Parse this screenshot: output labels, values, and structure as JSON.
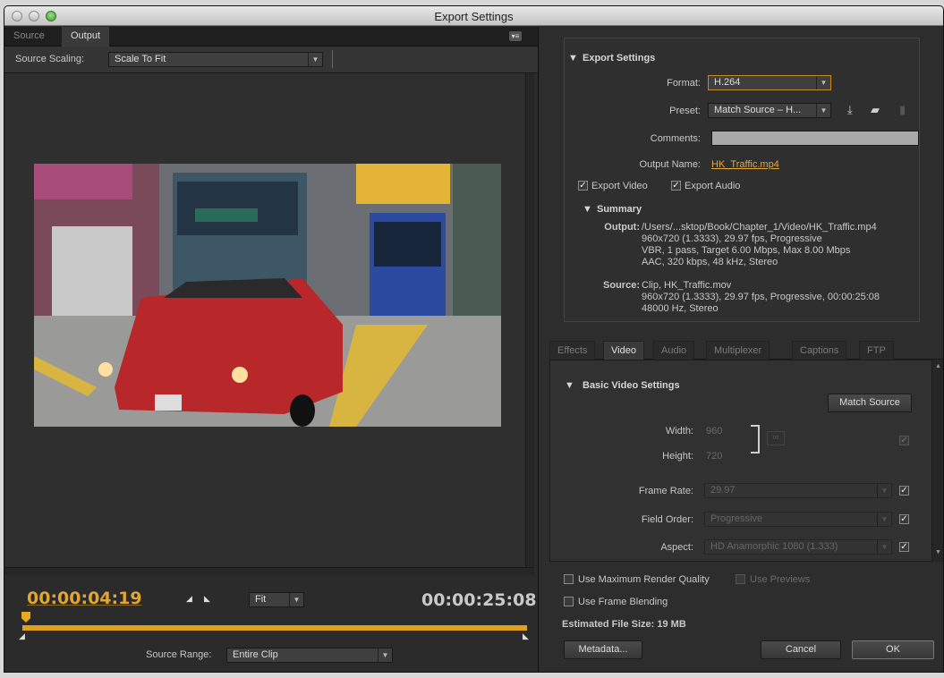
{
  "window": {
    "title": "Export Settings"
  },
  "left": {
    "tabs": [
      "Source",
      "Output"
    ],
    "panel_menu_icon": "panel-menu-icon",
    "source_scaling_label": "Source Scaling:",
    "source_scaling_value": "Scale To Fit",
    "current_time": "00:00:04:19",
    "duration": "00:00:25:08",
    "zoom_value": "Fit",
    "source_range_label": "Source Range:",
    "source_range_value": "Entire Clip"
  },
  "export": {
    "header": "Export Settings",
    "format_label": "Format:",
    "format_value": "H.264",
    "preset_label": "Preset:",
    "preset_value": "Match Source – H...",
    "comments_label": "Comments:",
    "output_name_label": "Output Name:",
    "output_name_value": "HK_Traffic.mp4",
    "export_video_label": "Export Video",
    "export_audio_label": "Export Audio",
    "summary_header": "Summary",
    "output_key": "Output:",
    "output_lines": "/Users/...sktop/Book/Chapter_1/Video/HK_Traffic.mp4\n960x720 (1.3333), 29.97 fps, Progressive\nVBR, 1 pass, Target 6.00 Mbps, Max 8.00 Mbps\nAAC, 320 kbps, 48 kHz, Stereo",
    "source_key": "Source:",
    "source_lines": "Clip, HK_Traffic.mov\n960x720 (1.3333), 29.97 fps, Progressive, 00:00:25:08\n48000 Hz, Stereo"
  },
  "tabs": [
    "Effects",
    "Video",
    "Audio",
    "Multiplexer",
    "Captions",
    "FTP"
  ],
  "video": {
    "header": "Basic Video Settings",
    "match_source_label": "Match Source",
    "width_label": "Width:",
    "width_value": "960",
    "height_label": "Height:",
    "height_value": "720",
    "frame_rate_label": "Frame Rate:",
    "frame_rate_value": "29.97",
    "field_order_label": "Field Order:",
    "field_order_value": "Progressive",
    "aspect_label": "Aspect:",
    "aspect_value": "HD Anamorphic 1080 (1.333)"
  },
  "bottom": {
    "max_render_label": "Use Maximum Render Quality",
    "use_previews_label": "Use Previews",
    "frame_blending_label": "Use Frame Blending",
    "file_size": "Estimated File Size:  19 MB",
    "metadata_label": "Metadata...",
    "cancel_label": "Cancel",
    "ok_label": "OK"
  },
  "colors": {
    "accent": "#e1a532",
    "timeline": "#e0a21a",
    "panel": "#2d2d2d"
  }
}
